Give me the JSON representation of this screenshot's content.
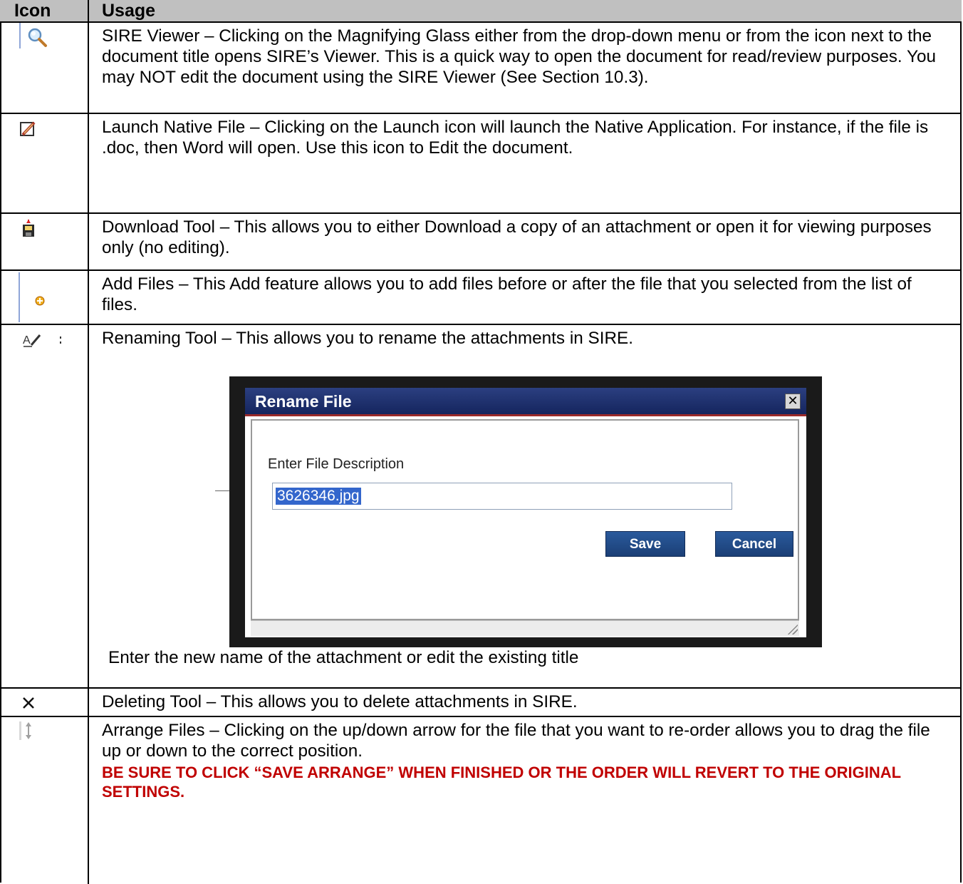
{
  "header": {
    "icon": "Icon",
    "usage": "Usage"
  },
  "rows": [
    {
      "icon": "magnifying-glass-icon",
      "text": "SIRE Viewer – Clicking on the Magnifying Glass either from the drop-down menu or from the icon next to the document title opens SIRE’s Viewer. This is a quick way to open the document for read/review purposes. You may NOT edit the document using the SIRE Viewer (See Section 10.3)."
    },
    {
      "icon": "pencil-icon",
      "text": "Launch Native File – Clicking on the Launch icon will launch the Native Application. For instance, if the file is .doc, then Word will open. Use this icon to Edit the document."
    },
    {
      "icon": "download-icon",
      "text": "Download Tool – This allows you to either Download a copy of an attachment or open it for viewing purposes only (no editing)."
    },
    {
      "icon": "add-icon",
      "text": "Add Files – This Add feature allows you to add files before or after the file that you selected from the list of files."
    },
    {
      "icon": "rename-icon",
      "text": "Renaming Tool – This allows you to rename the attachments in SIRE.",
      "note": "Enter the new name of the attachment or edit the existing title"
    },
    {
      "icon": "delete-icon",
      "text": "Deleting Tool – This allows you to delete attachments in SIRE."
    },
    {
      "icon": "arrange-icon",
      "text": "Arrange Files – Clicking on the up/down arrow for the file that you want to re-order allows you to drag the file up or down to the correct position.",
      "warning": "BE SURE TO CLICK “SAVE ARRANGE” WHEN FINISHED OR THE ORDER WILL REVERT TO THE ORIGINAL SETTINGS."
    }
  ],
  "dialog": {
    "title": "Rename File",
    "label": "Enter File Description",
    "value": "3626346.jpg",
    "save": "Save",
    "cancel": "Cancel"
  },
  "colors": {
    "header_bg": "#c0c0c0",
    "warning": "#c00000",
    "dialog_title": "#1f3170",
    "button": "#1f4a88"
  }
}
